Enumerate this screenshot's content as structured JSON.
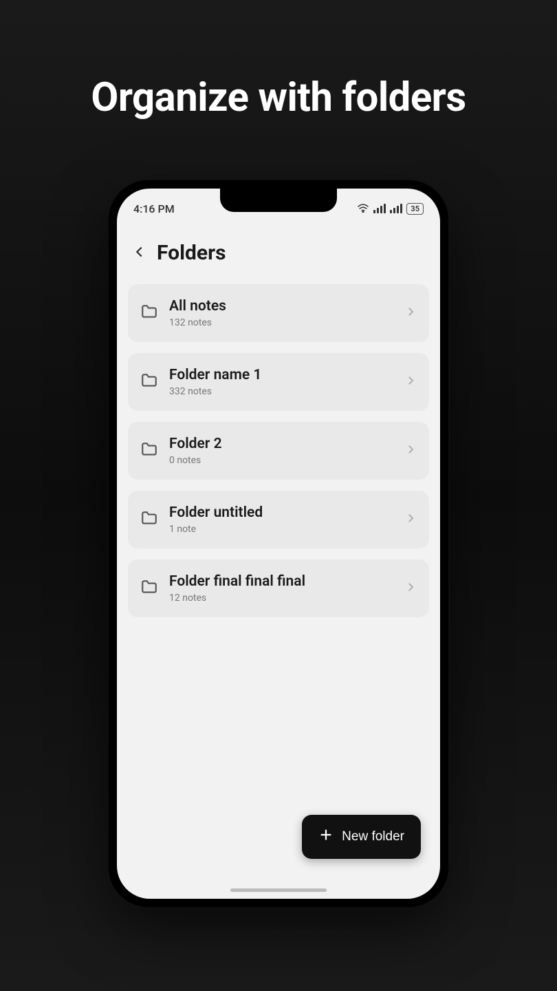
{
  "headline": "Organize with folders",
  "status": {
    "time": "4:16 PM",
    "battery": "35"
  },
  "header": {
    "title": "Folders"
  },
  "folders": [
    {
      "name": "All notes",
      "count": "132 notes"
    },
    {
      "name": "Folder name 1",
      "count": "332 notes"
    },
    {
      "name": "Folder 2",
      "count": "0 notes"
    },
    {
      "name": "Folder untitled",
      "count": "1 note"
    },
    {
      "name": "Folder final final final",
      "count": "12 notes"
    }
  ],
  "new_folder_button": "New folder"
}
